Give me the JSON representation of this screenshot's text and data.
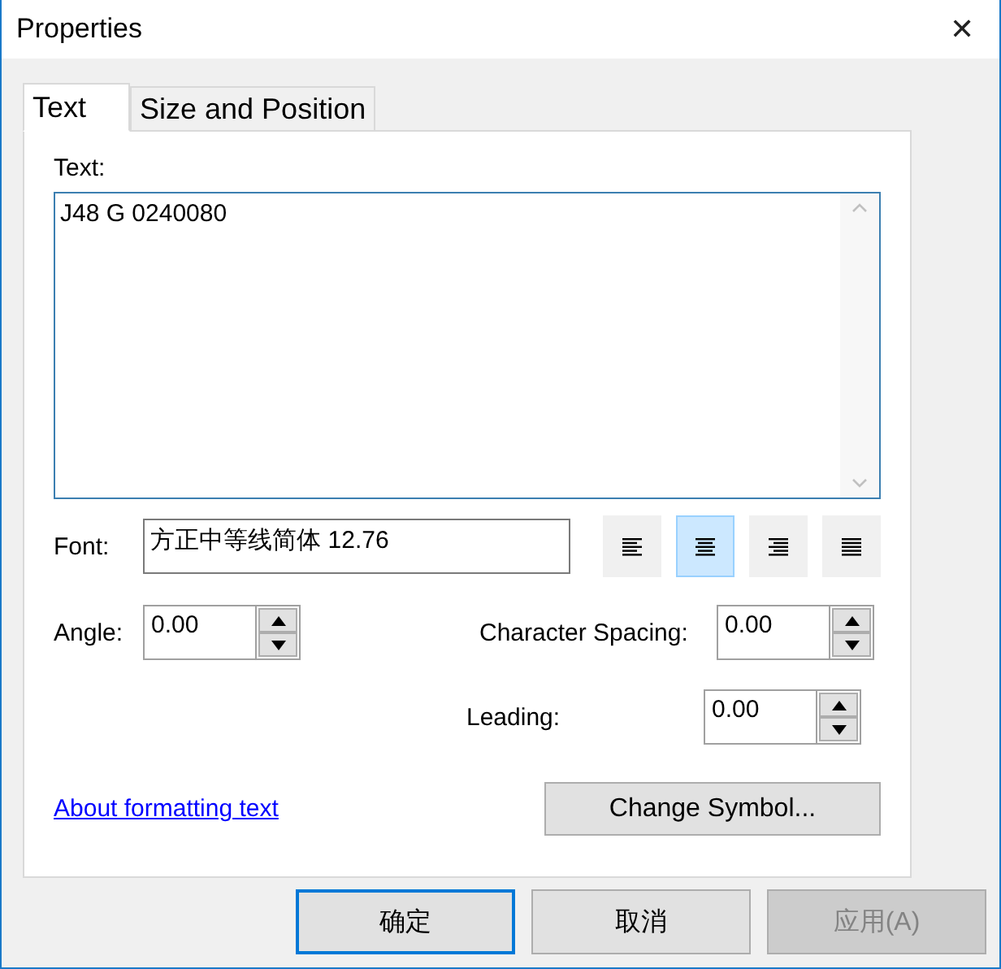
{
  "window": {
    "title": "Properties",
    "close": "✕"
  },
  "tabs": [
    {
      "label": "Text",
      "selected": true
    },
    {
      "label": "Size and Position",
      "selected": false
    }
  ],
  "text_field": {
    "label": "Text:",
    "value": "J48 G 0240080"
  },
  "font": {
    "label": "Font:",
    "value": "方正中等线简体 12.76"
  },
  "alignment": [
    {
      "kind": "left",
      "selected": false
    },
    {
      "kind": "center",
      "selected": true
    },
    {
      "kind": "right",
      "selected": false
    },
    {
      "kind": "justify",
      "selected": false
    }
  ],
  "angle": {
    "label": "Angle:",
    "value": "0.00"
  },
  "character_spacing": {
    "label": "Character Spacing:",
    "value": "0.00"
  },
  "leading": {
    "label": "Leading:",
    "value": "0.00"
  },
  "link": "About formatting text",
  "change_symbol": "Change Symbol...",
  "buttons": [
    {
      "label": "确定",
      "default": true,
      "disabled": false
    },
    {
      "label": "取消",
      "default": false,
      "disabled": false
    },
    {
      "label": "应用(A)",
      "default": false,
      "disabled": true
    }
  ]
}
